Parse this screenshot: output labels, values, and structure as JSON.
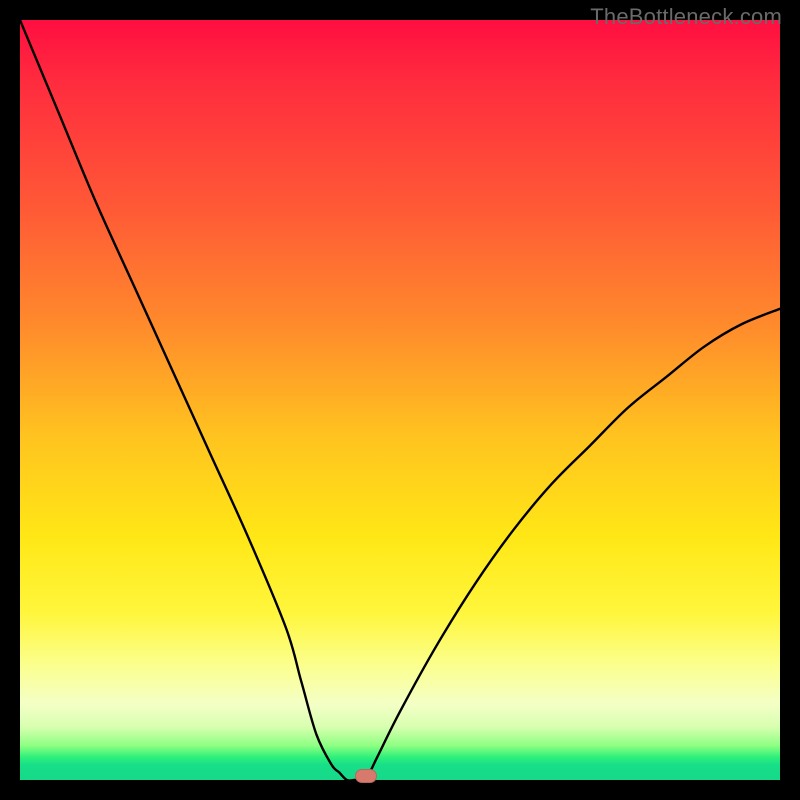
{
  "watermark": "TheBottleneck.com",
  "chart_data": {
    "type": "line",
    "title": "",
    "xlabel": "",
    "ylabel": "",
    "xlim": [
      0,
      100
    ],
    "ylim": [
      0,
      100
    ],
    "series": [
      {
        "name": "bottleneck-curve",
        "x": [
          0,
          5,
          10,
          15,
          20,
          25,
          30,
          35,
          37,
          39,
          41,
          42,
          43,
          44,
          45,
          46,
          47,
          50,
          55,
          60,
          65,
          70,
          75,
          80,
          85,
          90,
          95,
          100
        ],
        "values": [
          100,
          88,
          76,
          65,
          54,
          43,
          32,
          20,
          13,
          6,
          2,
          1,
          0,
          0,
          0,
          1,
          3,
          9,
          18,
          26,
          33,
          39,
          44,
          49,
          53,
          57,
          60,
          62
        ]
      }
    ],
    "annotations": [
      {
        "name": "marker-dot",
        "x": 45.5,
        "y": 0.5
      }
    ],
    "background_gradient": {
      "top": "#ff0e41",
      "mid": "#ffe716",
      "bottom": "#16d98a"
    }
  }
}
